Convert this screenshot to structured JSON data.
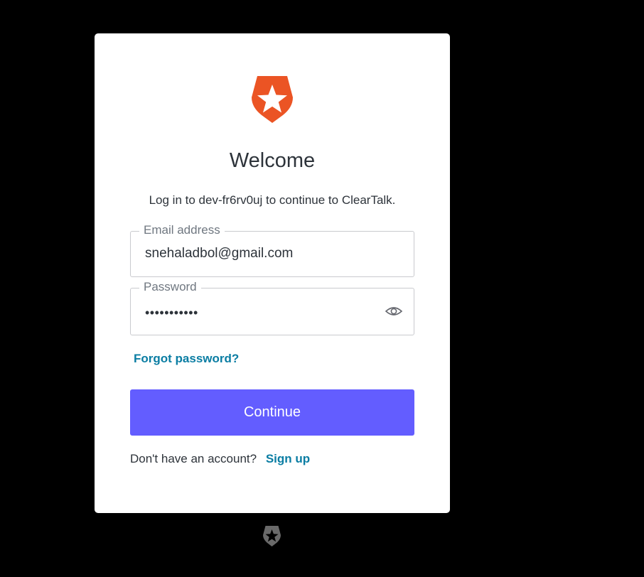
{
  "login": {
    "title": "Welcome",
    "subtitle": "Log in to dev-fr6rv0uj to continue to ClearTalk.",
    "email": {
      "label": "Email address",
      "value": "snehaladbol@gmail.com"
    },
    "password": {
      "label": "Password",
      "masked_value": "•••••••••••"
    },
    "forgot_password": "Forgot password?",
    "continue_label": "Continue",
    "signup_prompt": "Don't have an account?",
    "signup_link": "Sign up"
  },
  "icons": {
    "brand_logo": "auth0-shield-star-icon",
    "password_toggle": "eye-icon",
    "footer_logo": "auth0-shield-star-icon"
  },
  "colors": {
    "brand_orange": "#eb5424",
    "primary_button": "#635dff",
    "link": "#0a7da3",
    "text": "#2d333a",
    "background": "#000000"
  }
}
